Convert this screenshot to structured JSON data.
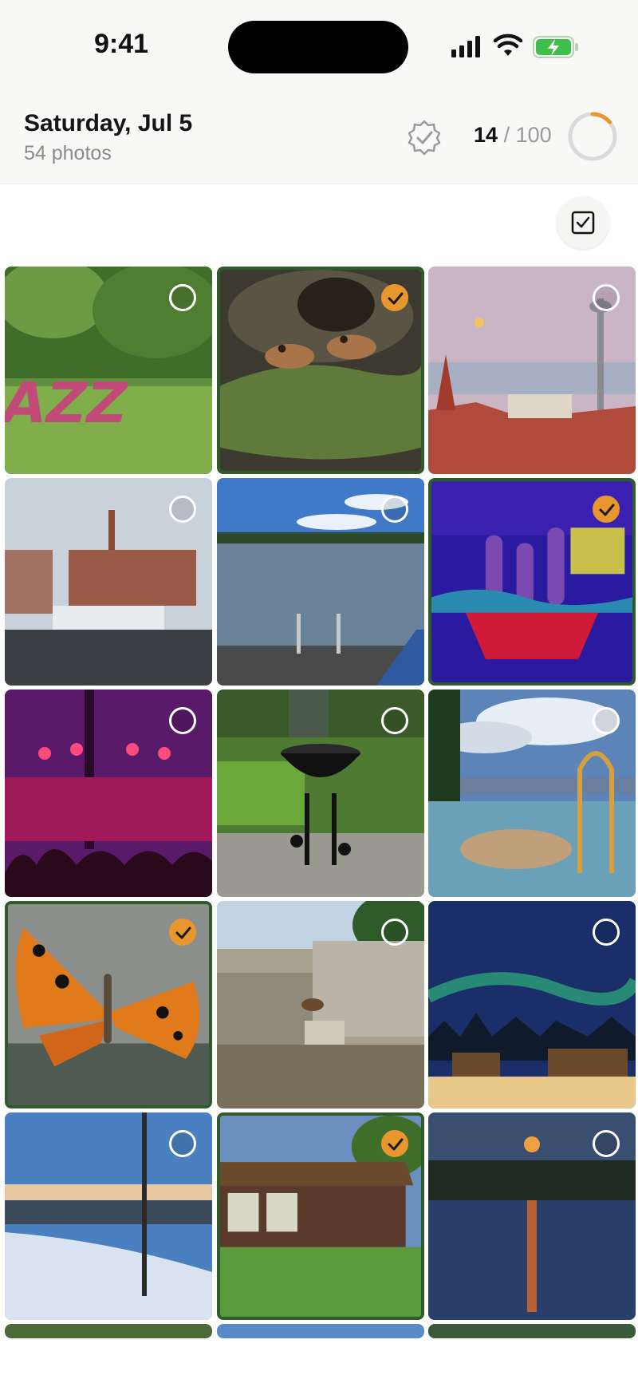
{
  "status_bar": {
    "time": "9:41",
    "icons": [
      "signal-icon",
      "wifi-icon",
      "battery-charging-icon"
    ]
  },
  "header": {
    "date_title": "Saturday, Jul 5",
    "photo_count": "54 photos",
    "verify_icon": "badge-check-icon",
    "quota_used": "14",
    "quota_total": "/ 100",
    "quota_progress": 0.14
  },
  "toolbar": {
    "select_all_icon": "checkbox-icon"
  },
  "colors": {
    "accent": "#e8962e",
    "selected_border": "#2f5a2a"
  },
  "photos": [
    {
      "subject": "jazz-flower-sign",
      "selected": false
    },
    {
      "subject": "frogs",
      "selected": true
    },
    {
      "subject": "tower-rooftops",
      "selected": false
    },
    {
      "subject": "factory-dam",
      "selected": false
    },
    {
      "subject": "lake-pier",
      "selected": false
    },
    {
      "subject": "ice-sculpture",
      "selected": true
    },
    {
      "subject": "concert",
      "selected": false
    },
    {
      "subject": "grill-garden",
      "selected": false
    },
    {
      "subject": "splash-park",
      "selected": false
    },
    {
      "subject": "butterfly",
      "selected": true
    },
    {
      "subject": "bear-enclosure",
      "selected": false
    },
    {
      "subject": "aurora-cabins",
      "selected": false
    },
    {
      "subject": "snowy-sunset",
      "selected": false
    },
    {
      "subject": "summer-house",
      "selected": true
    },
    {
      "subject": "moon-over-lake",
      "selected": false
    },
    {
      "subject": "partial-1",
      "selected": false
    },
    {
      "subject": "partial-2",
      "selected": false
    },
    {
      "subject": "partial-3",
      "selected": false
    }
  ]
}
